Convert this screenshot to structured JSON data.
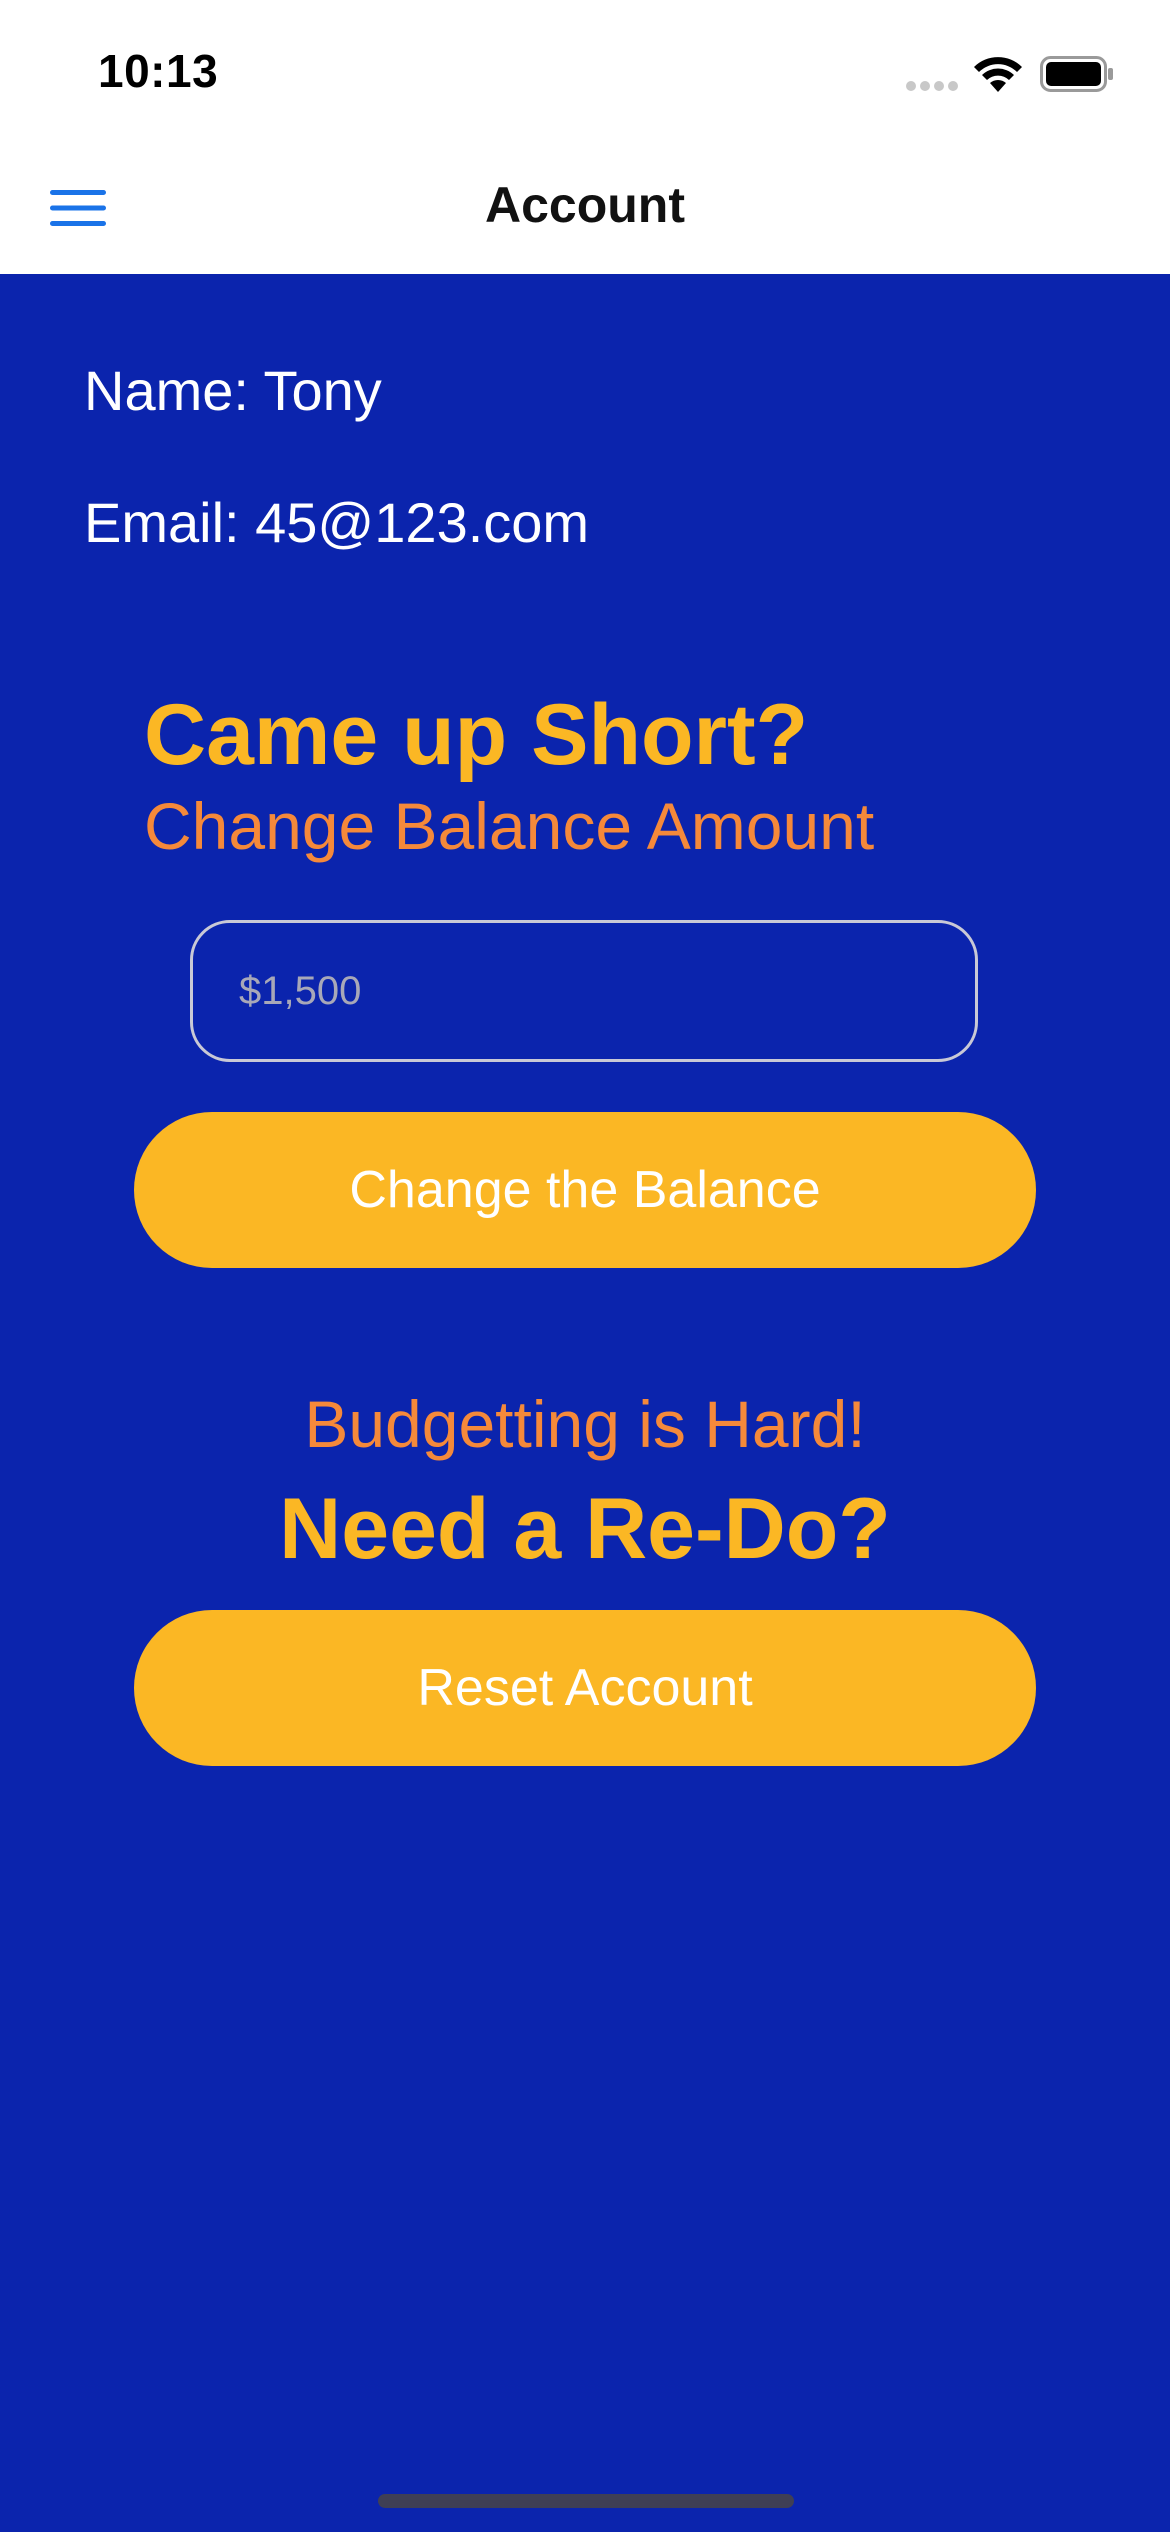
{
  "status_bar": {
    "time": "10:13",
    "icons": [
      "cellular-signal-icon",
      "wifi-icon",
      "battery-icon"
    ]
  },
  "nav": {
    "title": "Account",
    "menu_icon": "hamburger-menu-icon"
  },
  "account": {
    "name_text": "Name: Tony",
    "email_text": "Email: 45@123.com"
  },
  "balance_section": {
    "title": "Came up Short?",
    "subtitle": "Change Balance Amount",
    "input_placeholder": "$1,500",
    "input_value": "",
    "button_label": "Change the Balance"
  },
  "reset_section": {
    "subtitle": "Budgetting is Hard!",
    "title": "Need a Re-Do?",
    "button_label": "Reset Account"
  },
  "colors": {
    "background": "#0b24ad",
    "accent_yellow": "#fbb724",
    "accent_orange": "#f5893a",
    "nav_icon_blue": "#1a73e8"
  }
}
